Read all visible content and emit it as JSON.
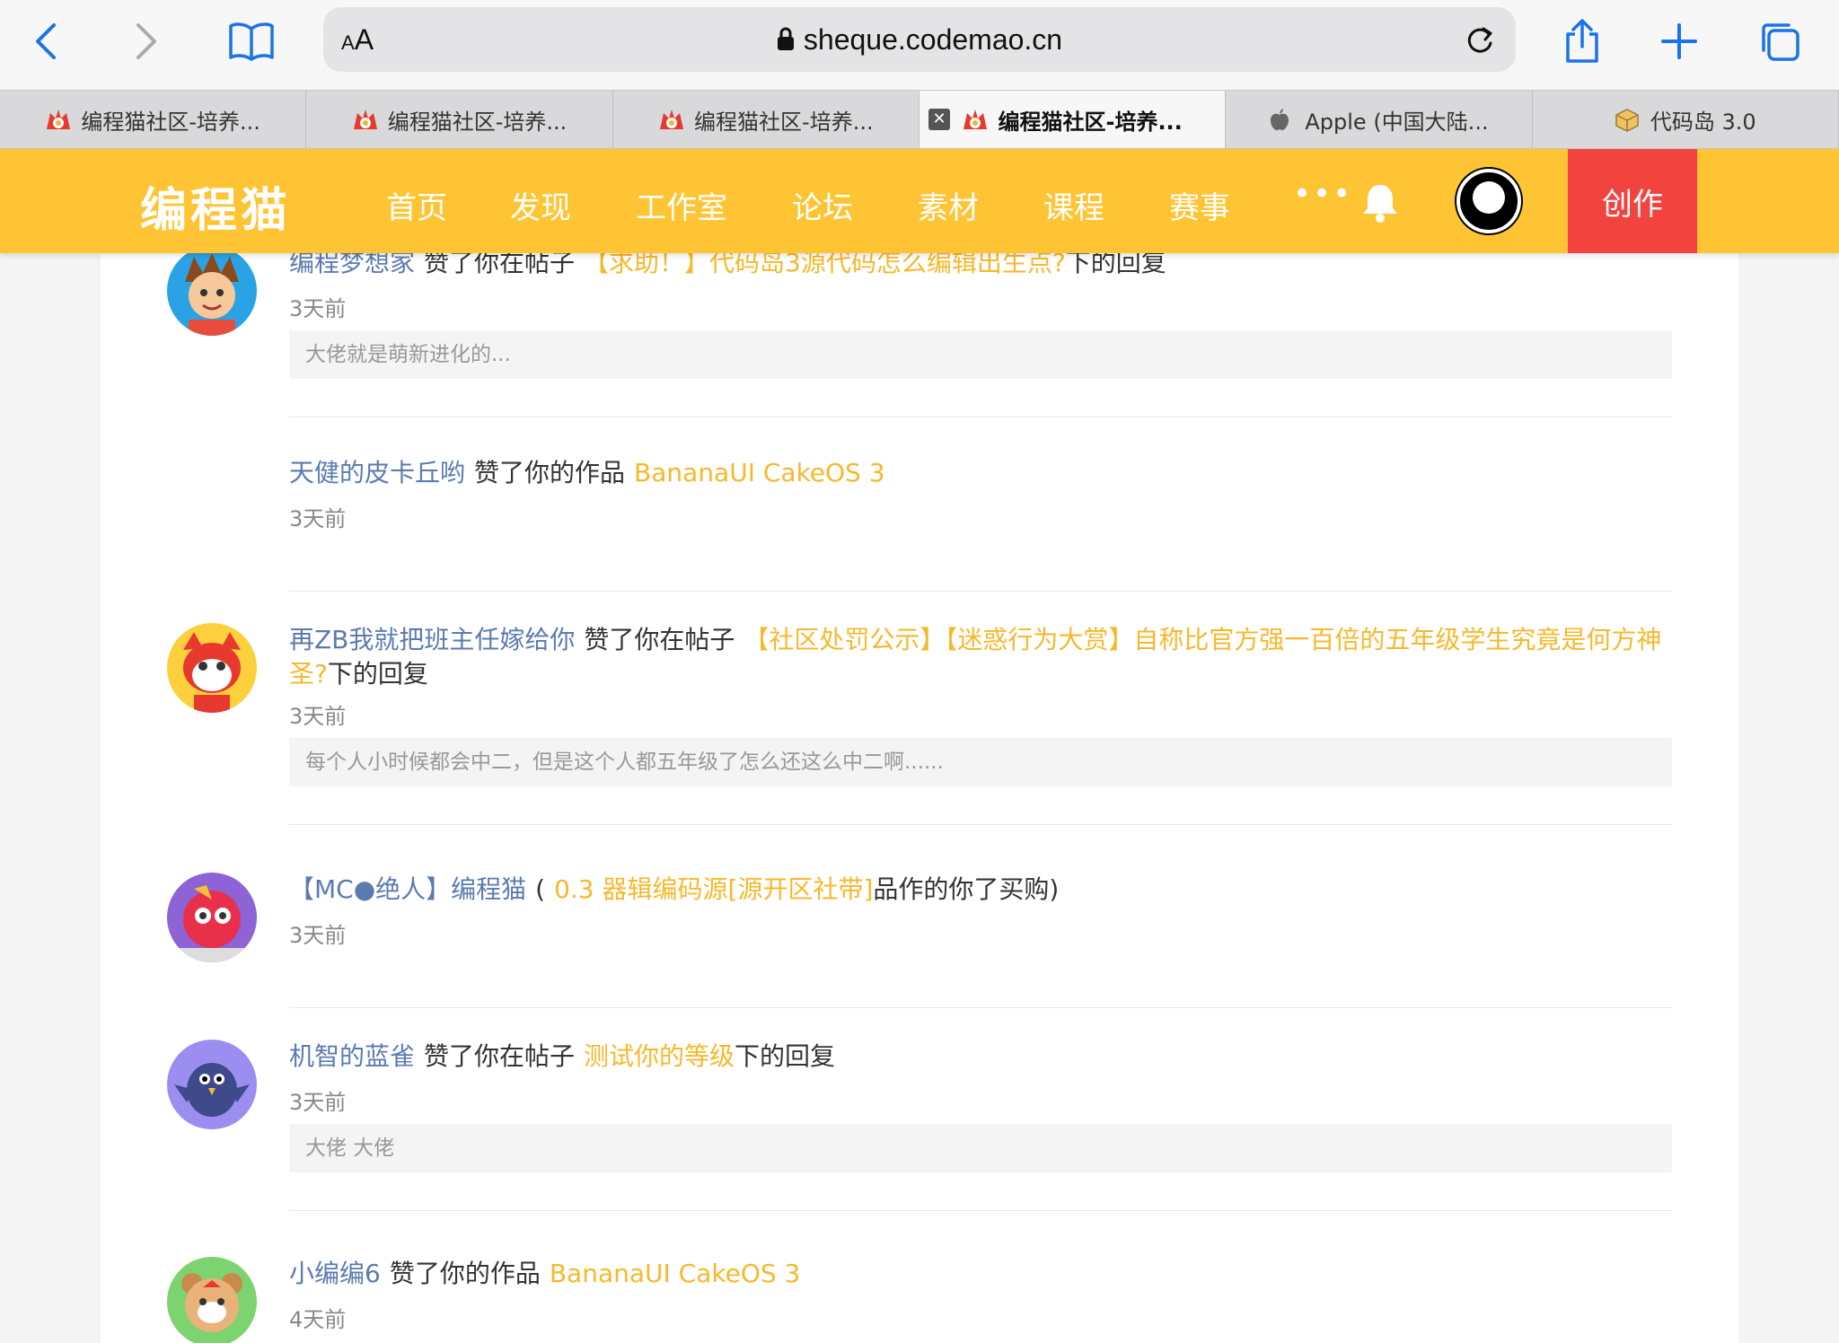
{
  "browser": {
    "aa_label": "AA",
    "url": "sheque.codemao.cn",
    "tabs": [
      {
        "label": "编程猫社区-培养...",
        "favicon": "codemao-icon",
        "active": false
      },
      {
        "label": "编程猫社区-培养...",
        "favicon": "codemao-icon",
        "active": false
      },
      {
        "label": "编程猫社区-培养...",
        "favicon": "codemao-icon",
        "active": false
      },
      {
        "label": "编程猫社区-培养...",
        "favicon": "codemao-icon",
        "active": true
      },
      {
        "label": "Apple (中国大陆...",
        "favicon": "apple-icon",
        "active": false
      },
      {
        "label": "代码岛 3.0",
        "favicon": "cube-icon",
        "active": false
      }
    ]
  },
  "site": {
    "logo": "编程猫",
    "nav": [
      "首页",
      "发现",
      "工作室",
      "论坛",
      "素材",
      "课程",
      "赛事"
    ],
    "more": "•••",
    "create": "创作",
    "accent": "#fec433",
    "create_color": "#f2433f"
  },
  "notifications": [
    {
      "user": "编程梦想家",
      "action": "赞了你在帖子",
      "target": "【求助！】代码岛3源代码怎么编辑出生点?",
      "suffix": "下的回复",
      "time": "3天前",
      "quote": "大佬就是萌新进化的...",
      "avatar": "boy-avatar"
    },
    {
      "user": "天健的皮卡丘哟",
      "action": "赞了你的作品",
      "target": "BananaUI CakeOS 3",
      "suffix": "",
      "time": "3天前",
      "quote": "",
      "avatar": ""
    },
    {
      "user": "再ZB我就把班主任嫁给你",
      "action": "赞了你在帖子",
      "target": "【社区处罚公示】【迷惑行为大赏】自称比官方强一百倍的五年级学生究竟是何方神圣?",
      "suffix": "下的回复",
      "time": "3天前",
      "quote": "每个人小时候都会中二，但是这个人都五年级了怎么还这么中二啊......",
      "avatar": "cat-avatar"
    },
    {
      "user": "【MC●绝人】编程猫",
      "action": "(",
      "target": "0.3 器辑编码源[源开区社带]",
      "suffix": "品作的你了买购)",
      "time": "3天前",
      "quote": "",
      "avatar": "fish-avatar"
    },
    {
      "user": "机智的蓝雀",
      "action": "赞了你在帖子",
      "target": "测试你的等级",
      "suffix": "下的回复",
      "time": "3天前",
      "quote": "大佬 大佬",
      "avatar": "bird-avatar"
    },
    {
      "user": "小编编6",
      "action": "赞了你的作品",
      "target": "BananaUI CakeOS 3",
      "suffix": "",
      "time": "4天前",
      "quote": "",
      "avatar": "bear-avatar"
    }
  ]
}
